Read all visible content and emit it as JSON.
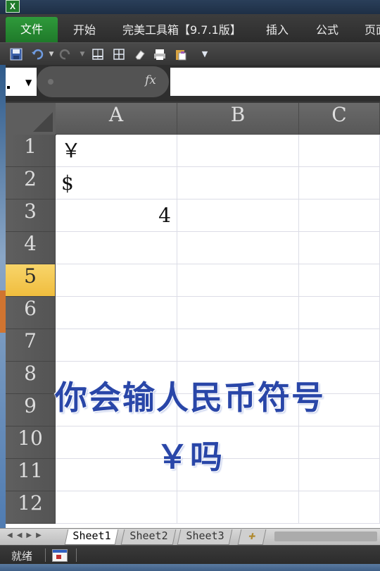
{
  "app": {
    "icon_letter": "X"
  },
  "ribbon": {
    "tabs": [
      {
        "label": "文件",
        "active": true
      },
      {
        "label": "开始"
      },
      {
        "label": "完美工具箱【9.7.1版】"
      },
      {
        "label": "插入"
      },
      {
        "label": "公式"
      },
      {
        "label": "页面"
      }
    ]
  },
  "quick_access": {
    "items": [
      "save-icon",
      "undo-icon",
      "redo-icon",
      "borders-icon",
      "grid-icon",
      "eraser-icon",
      "print-preview-icon",
      "paste-icon",
      "customize-dropdown-icon"
    ]
  },
  "formula_bar": {
    "fx_label": "fx",
    "content": ""
  },
  "sheet": {
    "columns": [
      "A",
      "B",
      "C"
    ],
    "rows": [
      "1",
      "2",
      "3",
      "4",
      "5",
      "6",
      "7",
      "8",
      "9",
      "10",
      "11",
      "12"
    ],
    "selected_row": "5",
    "cells": {
      "A1": "￥",
      "A2": "$",
      "A3": "4"
    }
  },
  "overlay": {
    "line1": "你会输人民币符号",
    "line2": "￥吗"
  },
  "sheet_tabs": [
    "Sheet1",
    "Sheet2",
    "Sheet3"
  ],
  "active_sheet": "Sheet1",
  "status": {
    "text": "就绪"
  },
  "colors": {
    "overlay_text": "#2946a8",
    "selected_row_header": "#f0bd3e",
    "file_tab": "#1f7a2a"
  }
}
